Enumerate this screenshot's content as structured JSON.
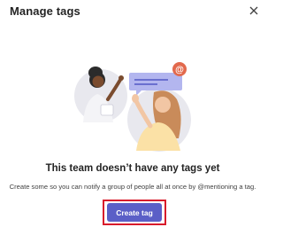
{
  "dialog": {
    "title": "Manage tags",
    "close_icon": "close-icon"
  },
  "empty_state": {
    "heading": "This team doesn’t have any tags yet",
    "description": "Create some so you can notify a group of people all at once by @mentioning a tag.",
    "illustration": "people-mention-illustration"
  },
  "actions": {
    "create_label": "Create tag"
  },
  "colors": {
    "primary": "#5b5fc7",
    "highlight": "#d81b2b",
    "mention_badge": "#e2694d"
  }
}
